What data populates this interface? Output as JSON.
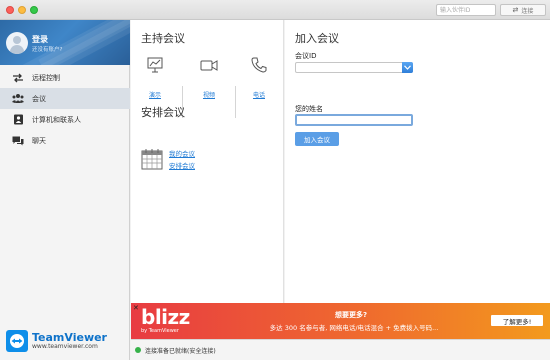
{
  "titlebar": {
    "partner_placeholder": "输入伙伴ID",
    "connect_label": "连接"
  },
  "sidebar": {
    "profile": {
      "login": "登录",
      "subtitle": "还没有账户?"
    },
    "items": [
      {
        "label": "远程控制",
        "icon": "arrows-icon",
        "active": false
      },
      {
        "label": "会议",
        "icon": "meeting-icon",
        "active": true
      },
      {
        "label": "计算机和联系人",
        "icon": "contacts-icon",
        "active": false
      },
      {
        "label": "聊天",
        "icon": "chat-icon",
        "active": false
      }
    ],
    "brand": {
      "name": "TeamViewer",
      "url": "www.teamviewer.com"
    }
  },
  "host": {
    "title": "主持会议",
    "actions": [
      {
        "label": "演示",
        "icon": "presentation-icon"
      },
      {
        "label": "视频",
        "icon": "video-camera-icon"
      },
      {
        "label": "电话",
        "icon": "phone-icon"
      }
    ],
    "schedule_title": "安排会议",
    "schedule_links": [
      "我的会议",
      "安排会议"
    ]
  },
  "join": {
    "title": "加入会议",
    "meeting_id_label": "会议ID",
    "meeting_id_value": "",
    "name_label": "您的姓名",
    "name_value": "",
    "join_button": "加入会议"
  },
  "ad": {
    "close": "✕",
    "brand": "blizz",
    "brand_by": "by TeamViewer",
    "headline": "想要更多?",
    "body": "多达 300 名参与者, 网络电话/电话混合 + 免费拨入号码...",
    "button": "了解更多!"
  },
  "status": {
    "text": "连接准备已就绪(安全连接)",
    "color": "#36b24a"
  }
}
